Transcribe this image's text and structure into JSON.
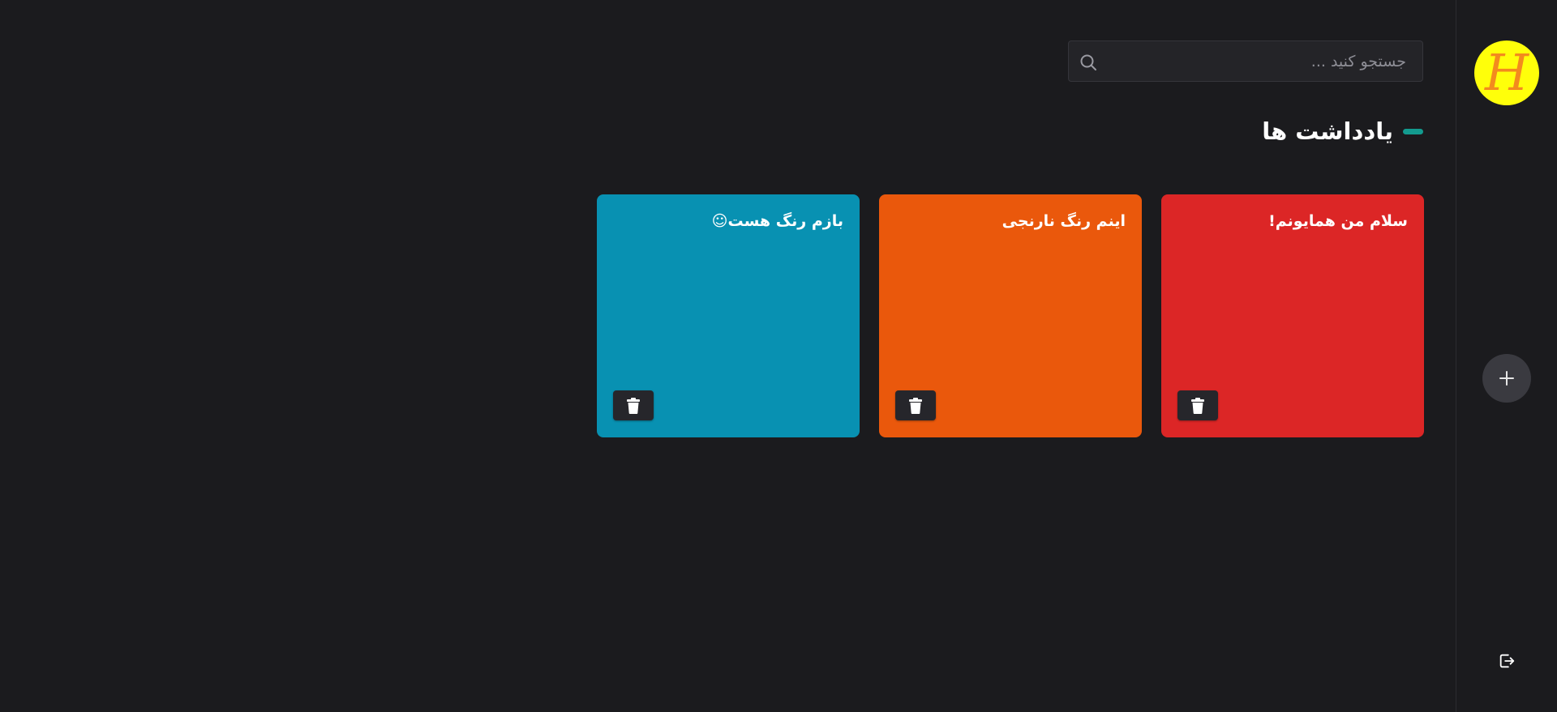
{
  "sidebar": {
    "avatar_letter": "H",
    "add_label": "+"
  },
  "search": {
    "placeholder": "جستجو کنید ..."
  },
  "heading": {
    "title": "یادداشت ها",
    "accent_color": "#139b8f"
  },
  "notes": [
    {
      "text": "سلام من همایونم!",
      "color": "#dc2626"
    },
    {
      "text": "اینم رنگ نارنجی",
      "color": "#ea580c"
    },
    {
      "text": "بازم رنگ هست☺",
      "color": "#0891b2"
    }
  ],
  "icons": {
    "search": "search-icon",
    "add": "plus-icon",
    "delete": "trash-icon",
    "logout": "logout-icon"
  }
}
